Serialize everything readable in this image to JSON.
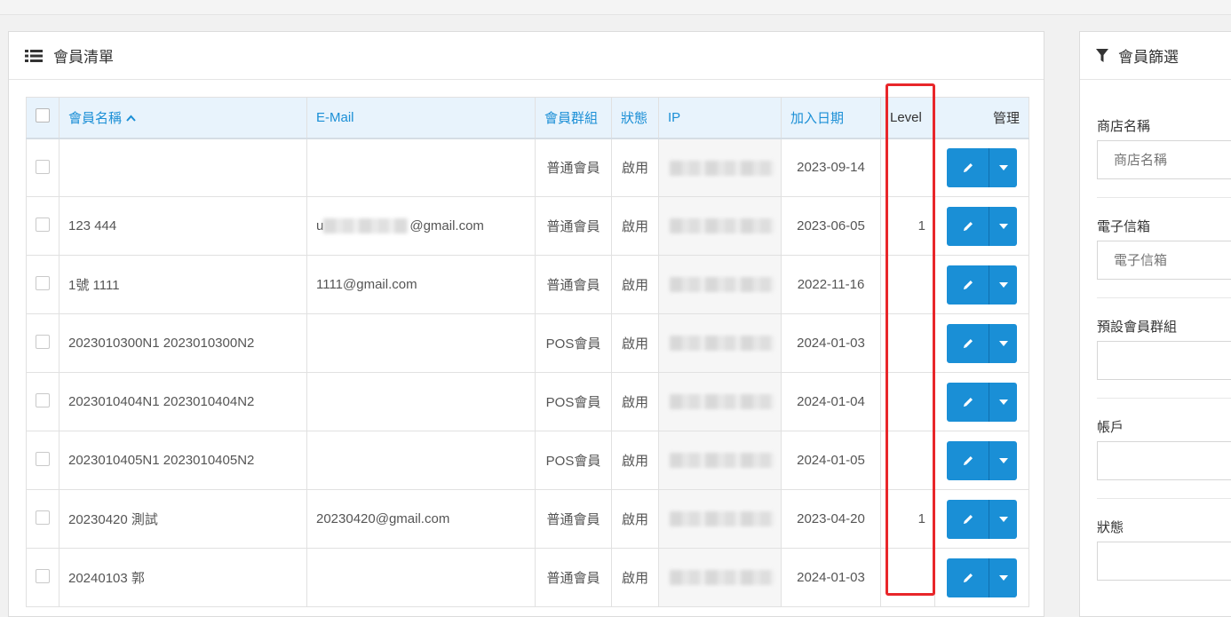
{
  "member_list": {
    "title": "會員清單",
    "columns": {
      "name": "會員名稱",
      "email": "E-Mail",
      "group": "會員群組",
      "status": "狀態",
      "ip": "IP",
      "join_date": "加入日期",
      "level": "Level",
      "manage": "管理"
    },
    "rows": [
      {
        "name": "",
        "email": "",
        "email_visible_part": "",
        "group": "普通會員",
        "status": "啟用",
        "join_date": "2023-09-14",
        "level": ""
      },
      {
        "name": "123 444",
        "email": "u",
        "email_visible_part": "@gmail.com",
        "group": "普通會員",
        "status": "啟用",
        "join_date": "2023-06-05",
        "level": "1"
      },
      {
        "name": "1號 1111",
        "email": "1111@gmail.com",
        "email_visible_part": "",
        "group": "普通會員",
        "status": "啟用",
        "join_date": "2022-11-16",
        "level": ""
      },
      {
        "name": "2023010300N1 2023010300N2",
        "email": "",
        "email_visible_part": "",
        "group": "POS會員",
        "status": "啟用",
        "join_date": "2024-01-03",
        "level": ""
      },
      {
        "name": "2023010404N1 2023010404N2",
        "email": "",
        "email_visible_part": "",
        "group": "POS會員",
        "status": "啟用",
        "join_date": "2024-01-04",
        "level": ""
      },
      {
        "name": "2023010405N1 2023010405N2",
        "email": "",
        "email_visible_part": "",
        "group": "POS會員",
        "status": "啟用",
        "join_date": "2024-01-05",
        "level": ""
      },
      {
        "name": "20230420 測試",
        "email": "20230420@gmail.com",
        "email_visible_part": "",
        "group": "普通會員",
        "status": "啟用",
        "join_date": "2023-04-20",
        "level": "1"
      },
      {
        "name": "20240103 郭",
        "email": "",
        "email_visible_part": "",
        "group": "普通會員",
        "status": "啟用",
        "join_date": "2024-01-03",
        "level": ""
      }
    ]
  },
  "filter": {
    "title": "會員篩選",
    "fields": [
      {
        "label": "商店名稱",
        "placeholder": "商店名稱"
      },
      {
        "label": "電子信箱",
        "placeholder": "電子信箱"
      },
      {
        "label": "預設會員群組",
        "placeholder": ""
      },
      {
        "label": "帳戶",
        "placeholder": ""
      },
      {
        "label": "狀態",
        "placeholder": ""
      }
    ]
  },
  "colors": {
    "accent": "#1a8fd6",
    "header_bg": "#e8f3fc",
    "highlight": "#e8262a"
  },
  "icons": {
    "panel": "list-icon",
    "filter": "filter-icon",
    "edit": "pencil-icon",
    "dropdown": "caret-down-icon",
    "sort": "chevron-up-icon"
  }
}
